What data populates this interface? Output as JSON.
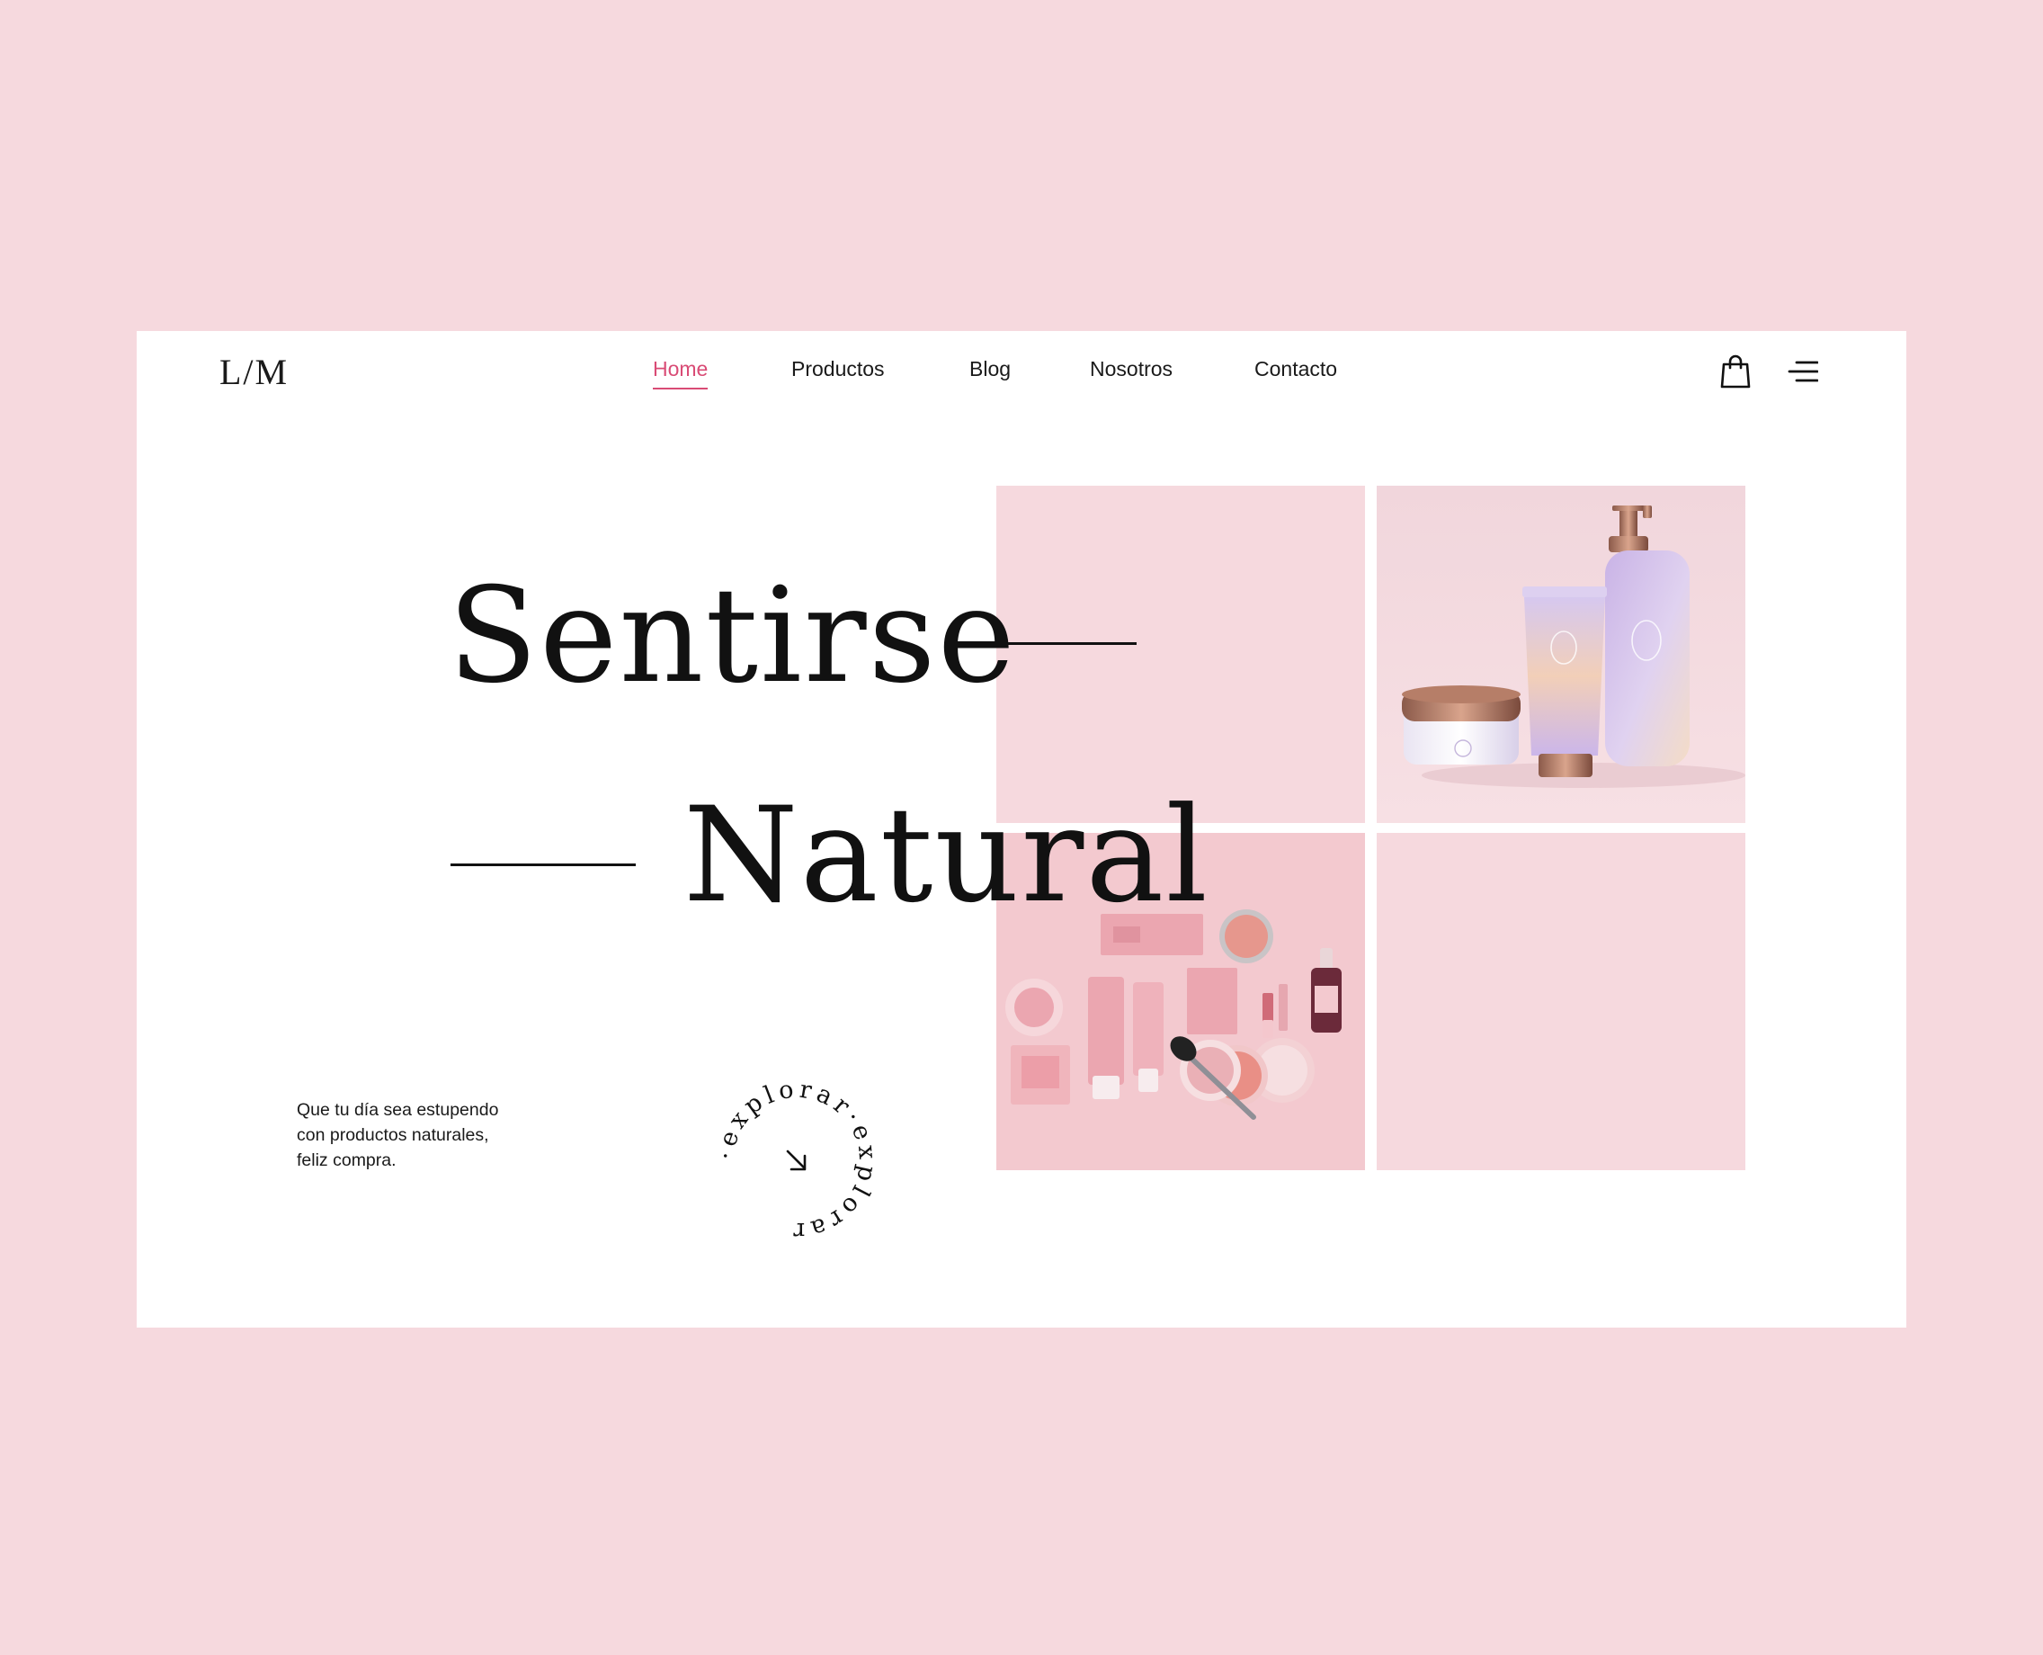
{
  "brand": {
    "logo_text": "L/M"
  },
  "nav": {
    "items": [
      {
        "label": "Home",
        "active": true
      },
      {
        "label": "Productos",
        "active": false
      },
      {
        "label": "Blog",
        "active": false
      },
      {
        "label": "Nosotros",
        "active": false
      },
      {
        "label": "Contacto",
        "active": false
      }
    ]
  },
  "header_icons": {
    "cart": "shopping-bag-icon",
    "menu": "hamburger-menu-icon"
  },
  "hero": {
    "line1": "Sentirse",
    "line2": "Natural",
    "tagline_lines": [
      "Que tu día sea estupendo",
      "con productos naturales,",
      "feliz compra."
    ],
    "explore_text": "·explorar·explorar"
  },
  "colors": {
    "page_background": "#f6d9de",
    "card_background": "#ffffff",
    "tile_pink": "#f6d9de",
    "accent_active": "#d94b75",
    "text_dark": "#111111"
  }
}
